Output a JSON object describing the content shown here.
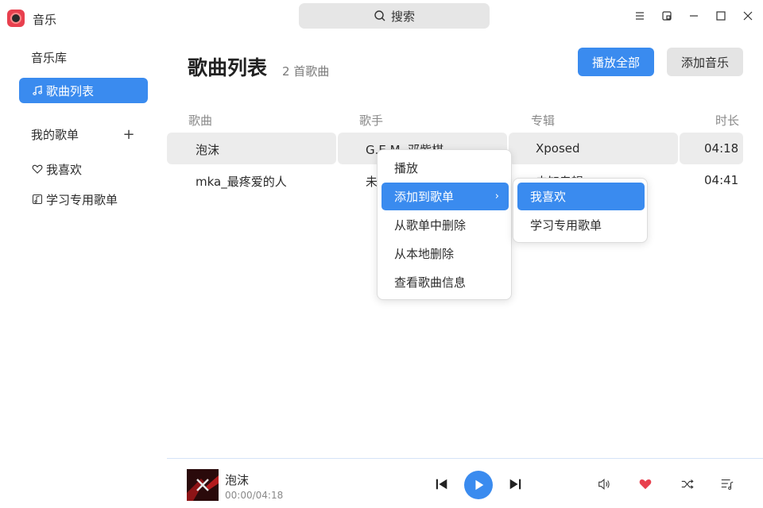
{
  "app": {
    "title": "音乐"
  },
  "search": {
    "label": "搜索"
  },
  "window_controls": [
    "menu",
    "mini-mode",
    "minimize",
    "maximize",
    "close"
  ],
  "sidebar": {
    "library_label": "音乐库",
    "songs_item": "歌曲列表",
    "playlists_header": "我的歌单",
    "add_playlist": "+",
    "playlists": [
      {
        "label": "我喜欢",
        "icon": "heart-icon"
      },
      {
        "label": "学习专用歌单",
        "icon": "music-note-icon"
      }
    ]
  },
  "main": {
    "title": "歌曲列表",
    "count": "2 首歌曲",
    "play_all": "播放全部",
    "add_music": "添加音乐",
    "columns": {
      "song": "歌曲",
      "artist": "歌手",
      "album": "专辑",
      "duration": "时长"
    },
    "rows": [
      {
        "song": "泡沫",
        "artist": "G.E.M. 邓紫棋",
        "album": "Xposed",
        "duration": "04:18",
        "selected": true
      },
      {
        "song": "mka_最疼爱的人",
        "artist": "未知歌手",
        "album": "未知专辑",
        "duration": "04:41",
        "selected": false
      }
    ]
  },
  "context_menu": {
    "items": [
      "播放",
      "添加到歌单",
      "从歌单中删除",
      "从本地删除",
      "查看歌曲信息"
    ],
    "highlighted": "添加到歌单",
    "submenu": [
      "我喜欢",
      "学习专用歌单"
    ]
  },
  "player": {
    "title": "泡沫",
    "time": "00:00/04:18",
    "liked": true,
    "colors": {
      "accent": "#3a8bef",
      "like": "#e8404e"
    }
  }
}
